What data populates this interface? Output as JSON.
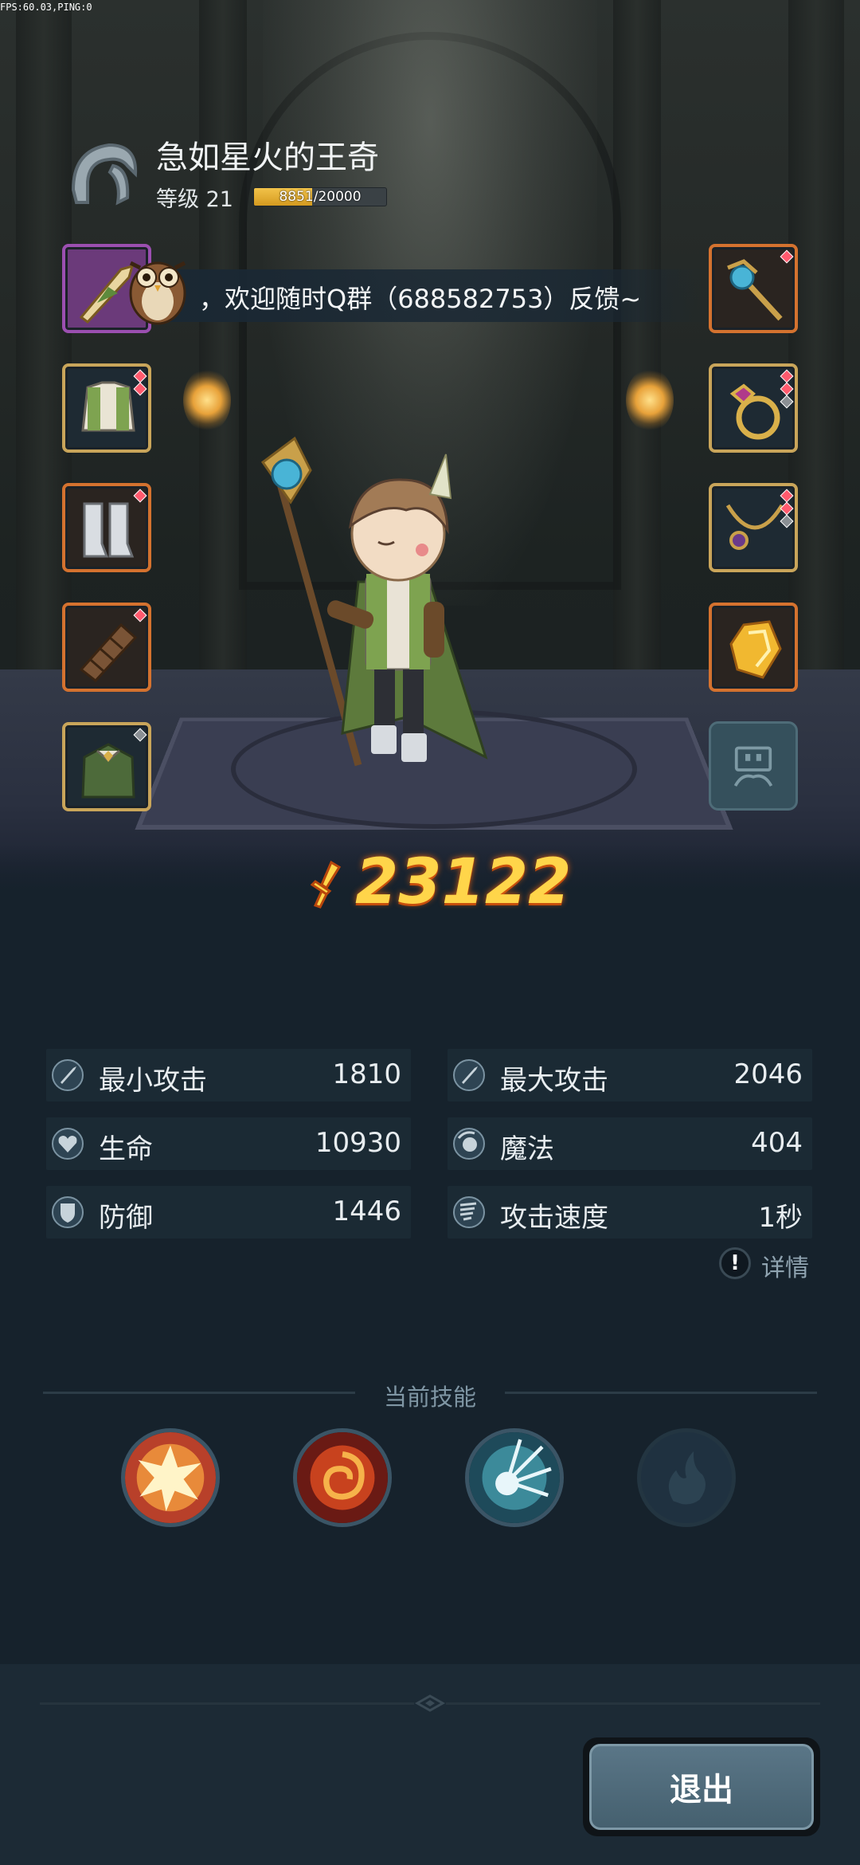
{
  "debug": {
    "fps_text": "FPS:60.03,PING:0"
  },
  "player": {
    "name": "急如星火的王奇",
    "level_label": "等级 21",
    "xp_text": "8851/20000",
    "xp_fraction": 0.4426
  },
  "banner": {
    "text": "，欢迎随时Q群（688582753）反馈~"
  },
  "equipment": {
    "left": [
      {
        "name": "spear-charm-icon",
        "rarity": "purple"
      },
      {
        "name": "armor-icon",
        "rarity": "gold"
      },
      {
        "name": "boots-icon",
        "rarity": "orange"
      },
      {
        "name": "bracer-icon",
        "rarity": "orange"
      },
      {
        "name": "cloak-icon",
        "rarity": "gold"
      }
    ],
    "right": [
      {
        "name": "staff-icon",
        "rarity": "orange"
      },
      {
        "name": "ring-icon",
        "rarity": "gold"
      },
      {
        "name": "necklace-icon",
        "rarity": "gold"
      },
      {
        "name": "crystal-icon",
        "rarity": "orange"
      },
      {
        "name": "locked-slot-icon",
        "rarity": "locked"
      }
    ]
  },
  "power": {
    "value": "23122"
  },
  "stats": {
    "min_attack": {
      "label": "最小攻击",
      "value": "1810"
    },
    "max_attack": {
      "label": "最大攻击",
      "value": "2046"
    },
    "hp": {
      "label": "生命",
      "value": "10930"
    },
    "mp": {
      "label": "魔法",
      "value": "404"
    },
    "defense": {
      "label": "防御",
      "value": "1446"
    },
    "attack_speed": {
      "label": "攻击速度",
      "value": "1秒"
    }
  },
  "details_label": "详情",
  "skills": {
    "title": "当前技能",
    "items": [
      {
        "name": "explosion-skill-icon"
      },
      {
        "name": "fire-vortex-skill-icon"
      },
      {
        "name": "ice-burst-skill-icon"
      },
      {
        "name": "empty-skill-slot-icon"
      }
    ]
  },
  "exit_label": "退出",
  "colors": {
    "background": "#16222c",
    "stat_row": "#1b2a34",
    "power": "#ffd54a",
    "xp_fill": "#f2c34a",
    "exit_button": "#4f6b7b"
  }
}
